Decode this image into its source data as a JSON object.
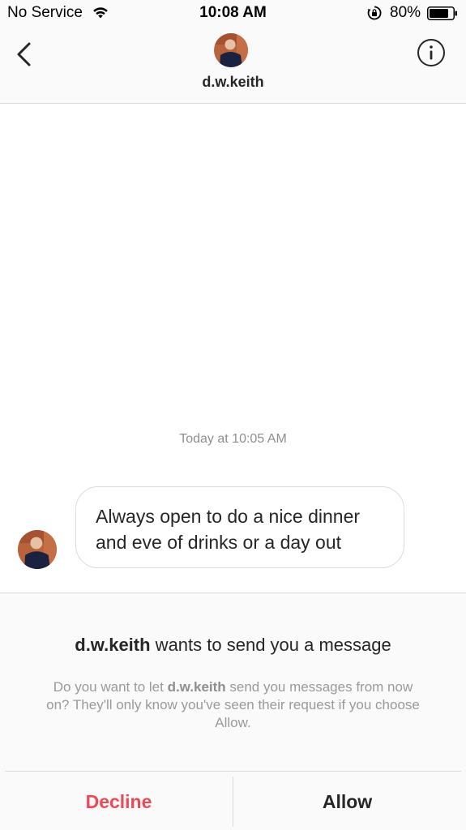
{
  "status_bar": {
    "carrier": "No Service",
    "time": "10:08 AM",
    "battery_percent": "80%",
    "icons": [
      "wifi-icon",
      "orientation-lock-icon",
      "battery-icon"
    ]
  },
  "header": {
    "username": "d.w.keith",
    "back_icon": "chevron-left-icon",
    "info_icon": "info-icon"
  },
  "thread": {
    "timestamp": "Today at 10:05 AM",
    "messages": [
      {
        "sender": "d.w.keith",
        "line1": "Always open to do a nice dinner",
        "line2": "and eve of drinks or a day out"
      }
    ]
  },
  "request": {
    "title_username": "d.w.keith",
    "title_rest": " wants to send you a message",
    "desc_prefix": "Do you want to let ",
    "desc_username": "d.w.keith",
    "desc_suffix": " send you messages from now on? They'll only know you've seen their request if you choose Allow.",
    "decline_label": "Decline",
    "allow_label": "Allow"
  },
  "colors": {
    "decline": "#ed4956",
    "text": "#262626",
    "secondary": "#8e8e8e",
    "border": "#dbdbdb"
  }
}
